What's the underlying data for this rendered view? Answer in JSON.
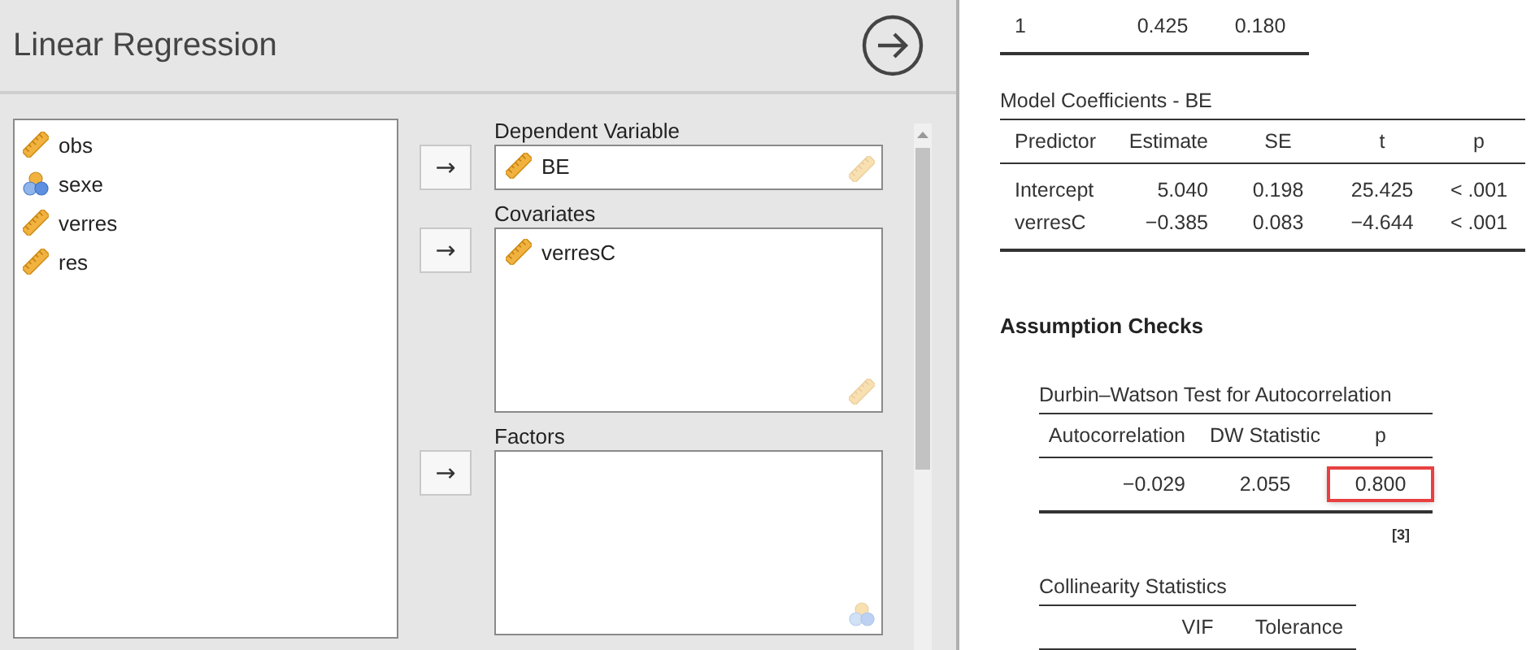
{
  "analysis": {
    "title": "Linear Regression"
  },
  "variables": [
    {
      "name": "obs",
      "kind": "continuous"
    },
    {
      "name": "sexe",
      "kind": "nominal"
    },
    {
      "name": "verres",
      "kind": "continuous"
    },
    {
      "name": "res",
      "kind": "continuous"
    }
  ],
  "targets": [
    {
      "label": "Dependent Variable",
      "button": "→",
      "kind": "single",
      "hint_icon": {
        "kind": "continuous"
      },
      "items": [
        {
          "name": "BE",
          "kind": "continuous"
        }
      ]
    },
    {
      "label": "Covariates",
      "button": "→",
      "kind": "list",
      "hint_icon": {
        "kind": "continuous"
      },
      "items": [
        {
          "name": "verresC",
          "kind": "continuous"
        }
      ]
    },
    {
      "label": "Factors",
      "button": "→",
      "kind": "list",
      "hint_icon": {
        "kind": "nominal"
      }
    }
  ],
  "results": {
    "top_table": {
      "rows": [
        [
          "1",
          "0.425",
          "0.180"
        ]
      ]
    },
    "model_coefficients": {
      "title": "Model Coefficients - BE",
      "columns": [
        "Predictor",
        "Estimate",
        "SE",
        "t",
        "p"
      ],
      "rows": [
        [
          "Intercept",
          "5.040",
          "0.198",
          "25.425",
          "< .001"
        ],
        [
          "verresC",
          "−0.385",
          "0.083",
          "−4.644",
          "< .001"
        ]
      ]
    },
    "assumption_checks": {
      "heading": "Assumption Checks",
      "tables": [
        {
          "title": "Durbin–Watson Test for Autocorrelation",
          "columns": [
            "Autocorrelation",
            "DW Statistic",
            "p"
          ],
          "rows": [
            [
              {
                "text": "−0.029",
                "highlighted": false
              },
              {
                "text": "2.055",
                "highlighted": false
              },
              {
                "text": "0.800",
                "highlighted": true
              }
            ]
          ],
          "footnote": "[3]"
        },
        {
          "title": "Collinearity Statistics",
          "columns": [
            "",
            "VIF",
            "Tolerance"
          ]
        }
      ]
    }
  }
}
